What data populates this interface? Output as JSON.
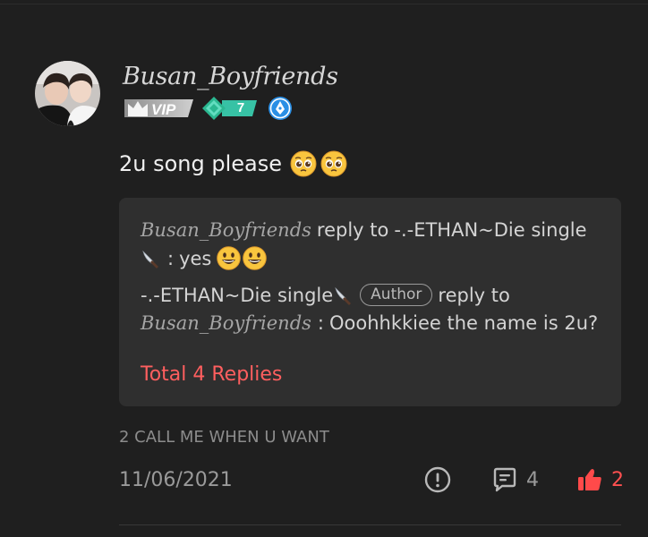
{
  "comment": {
    "username": "Busan_Boyfriends",
    "vip_label": "VIP",
    "level": "7",
    "text": "2u song please",
    "song_tag": "2 CALL ME WHEN U WANT",
    "date": "11/06/2021",
    "comment_count": "4",
    "like_count": "2"
  },
  "replies": [
    {
      "author": "Busan_Boyfriends",
      "connector": "reply to",
      "target": "-.-ETHAN~Die single",
      "text": "yes"
    },
    {
      "author": "-.-ETHAN~Die single",
      "author_tag": "Author",
      "connector": "reply to",
      "target": "Busan_Boyfriends",
      "text": "Ooohhkkiee the name is 2u?"
    }
  ],
  "total_replies_label": "Total 4 Replies",
  "colors": {
    "background": "#1f1f1f",
    "reply_box": "#2f2f2f",
    "accent_red": "#ff5f5f",
    "level_badge": "#37c2a5",
    "pen_badge": "#2a8fe5"
  },
  "icons": {
    "avatar": "user-avatar",
    "vip": "crown-icon",
    "level": "diamond-icon",
    "pen": "pen-nib-icon",
    "report": "exclamation-circle-icon",
    "comment": "speech-bubble-icon",
    "like": "thumbs-up-icon",
    "knife": "knife-emoji",
    "pleading": "pleading-face-emoji",
    "grin": "grinning-face-emoji"
  }
}
